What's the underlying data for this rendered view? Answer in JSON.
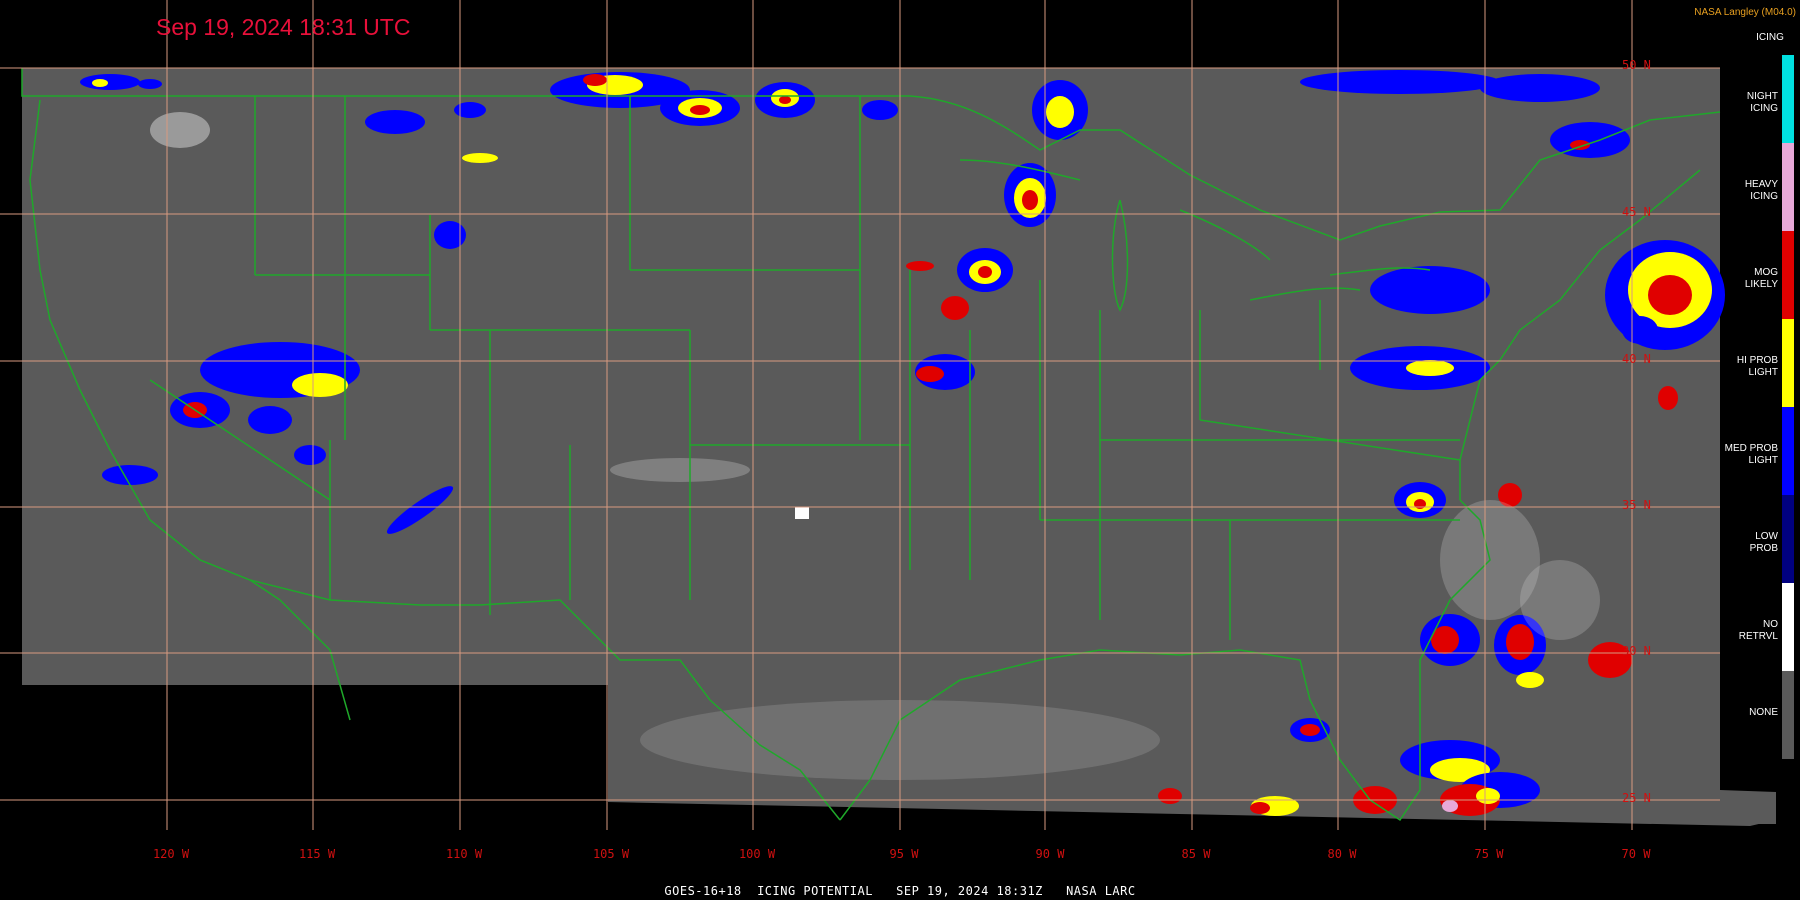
{
  "header": {
    "timestamp": "Sep 19, 2024 18:31 UTC",
    "credit": "NASA Langley (M04.0)"
  },
  "footer": {
    "caption": "GOES-16+18  ICING POTENTIAL   SEP 19, 2024 18:31Z   NASA LARC"
  },
  "grid": {
    "longitudes": [
      "120 W",
      "115 W",
      "110 W",
      "105 W",
      "100 W",
      "95 W",
      "90 W",
      "85 W",
      "80 W",
      "75 W",
      "70 W"
    ],
    "latitudes": [
      "50 N",
      "45 N",
      "40 N",
      "35 N",
      "30 N",
      "25 N"
    ]
  },
  "legend": {
    "title": "ICING",
    "items": [
      {
        "label": "NIGHT\nICING",
        "color": "#00e0e0"
      },
      {
        "label": "HEAVY\nICING",
        "color": "#e8a8d8"
      },
      {
        "label": "MOG\nLIKELY",
        "color": "#e00000"
      },
      {
        "label": "HI PROB\nLIGHT",
        "color": "#ffff00"
      },
      {
        "label": "MED PROB\nLIGHT",
        "color": "#0000ff"
      },
      {
        "label": "LOW\nPROB",
        "color": "#000080"
      },
      {
        "label": "NO\nRETRVL",
        "color": "#ffffff"
      },
      {
        "label": "NONE",
        "color": "#5a5a5a"
      }
    ]
  },
  "colors": {
    "background": "#000000",
    "no_icing_gray": "#5a5a5a",
    "border_green": "#1fa82a",
    "grid_salmon": "#d89a80"
  }
}
